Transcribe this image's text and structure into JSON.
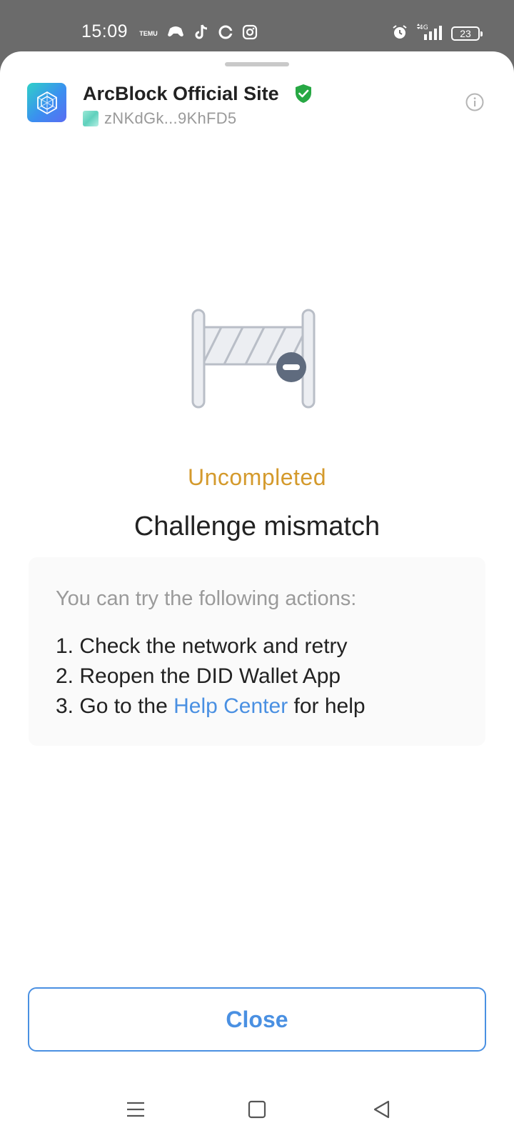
{
  "status_bar": {
    "time": "15:09",
    "app_icons": [
      "temu-icon",
      "game-icon",
      "tiktok-icon",
      "app-c-icon",
      "instagram-icon"
    ],
    "temu_label": "TEMU",
    "network": "4G",
    "battery": "23"
  },
  "header": {
    "app_title": "ArcBlock Official Site",
    "did": "zNKdGk...9KhFD5",
    "verified_color": "#27a844"
  },
  "result": {
    "status": "Uncompleted",
    "status_color": "#d49a2c",
    "title": "Challenge mismatch"
  },
  "actions": {
    "intro": "You can try the following actions:",
    "items": [
      "1. Check the network and retry",
      "2. Reopen the DID Wallet App"
    ],
    "item3_prefix": "3. Go to the ",
    "item3_link": "Help Center",
    "item3_suffix": " for help"
  },
  "footer": {
    "close_label": "Close",
    "accent_color": "#4a90e2"
  },
  "nav": [
    "menu-icon",
    "home-icon",
    "back-icon"
  ]
}
